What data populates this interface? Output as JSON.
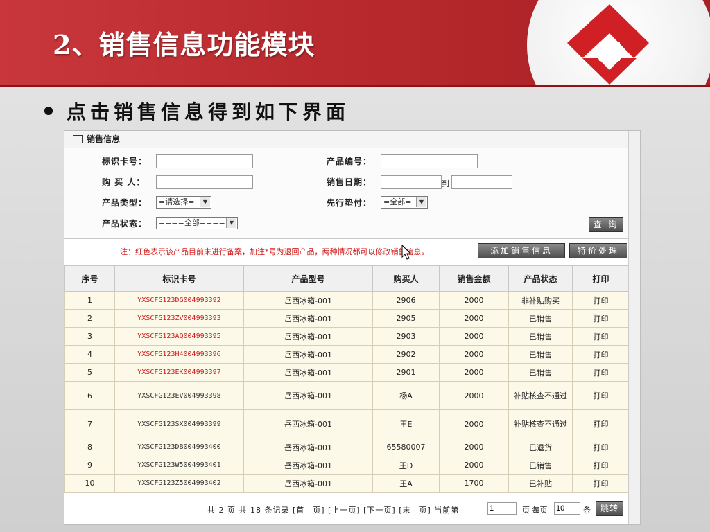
{
  "slide": {
    "title": "2、销售信息功能模块",
    "bullet": "点击销售信息得到如下界面"
  },
  "panel": {
    "title": "销售信息"
  },
  "form": {
    "card_label": "标识卡号：",
    "buyer_label": "购 买 人：",
    "type_label": "产品类型：",
    "state_label": "产品状态：",
    "product_no_label": "产品编号：",
    "date_label": "销售日期：",
    "date_to": "到",
    "advance_label": "先行垫付：",
    "type_value": "=请选择=",
    "advance_value": "=全部=",
    "state_value": "====全部=====",
    "query_button": "查 询"
  },
  "notice": "注：红色表示该产品目前未进行备案，加注*号为退回产品，两种情况都可以修改销售信息。",
  "actions": {
    "add_button": "添加销售信息",
    "special_button": "特价处理"
  },
  "table": {
    "headers": [
      "序号",
      "标识卡号",
      "产品型号",
      "购买人",
      "销售金额",
      "产品状态",
      "打印"
    ],
    "rows": [
      {
        "no": "1",
        "card": "YXSCFG123DG004993392",
        "model": "岳西冰箱-001",
        "buyer": "2906",
        "amount": "2000",
        "status": "非补贴购买",
        "print": "打印",
        "red": true
      },
      {
        "no": "2",
        "card": "YXSCFG123ZV004993393",
        "model": "岳西冰箱-001",
        "buyer": "2905",
        "amount": "2000",
        "status": "已销售",
        "print": "打印",
        "red": true
      },
      {
        "no": "3",
        "card": "YXSCFG123AQ004993395",
        "model": "岳西冰箱-001",
        "buyer": "2903",
        "amount": "2000",
        "status": "已销售",
        "print": "打印",
        "red": true
      },
      {
        "no": "4",
        "card": "YXSCFG123H4004993396",
        "model": "岳西冰箱-001",
        "buyer": "2902",
        "amount": "2000",
        "status": "已销售",
        "print": "打印",
        "red": true
      },
      {
        "no": "5",
        "card": "YXSCFG123EK004993397",
        "model": "岳西冰箱-001",
        "buyer": "2901",
        "amount": "2000",
        "status": "已销售",
        "print": "打印",
        "red": true
      },
      {
        "no": "6",
        "card": "YXSCFG123EV004993398",
        "model": "岳西冰箱-001",
        "buyer": "杨A",
        "amount": "2000",
        "status": "补贴核查不通过",
        "print": "打印",
        "red": false
      },
      {
        "no": "7",
        "card": "YXSCFG123SX004993399",
        "model": "岳西冰箱-001",
        "buyer": "王E",
        "amount": "2000",
        "status": "补贴核查不通过",
        "print": "打印",
        "red": false
      },
      {
        "no": "8",
        "card": "YXSCFG123DB004993400",
        "model": "岳西冰箱-001",
        "buyer": "65580007",
        "amount": "2000",
        "status": "已退货",
        "print": "打印",
        "red": false
      },
      {
        "no": "9",
        "card": "YXSCFG123W5004993401",
        "model": "岳西冰箱-001",
        "buyer": "王D",
        "amount": "2000",
        "status": "已销售",
        "print": "打印",
        "red": false
      },
      {
        "no": "10",
        "card": "YXSCFG123Z5004993402",
        "model": "岳西冰箱-001",
        "buyer": "王A",
        "amount": "1700",
        "status": "已补贴",
        "print": "打印",
        "red": false
      }
    ]
  },
  "pager": {
    "text": "共 2 页 共 18 条记录 [首　页] [上一页] [下一页] [末　页] 当前第",
    "current_page": "1",
    "per_page_label": "页 每页",
    "per_page": "10",
    "unit": "条",
    "jump_button": "跳转"
  },
  "colors": {
    "header_red": "#b92a2e",
    "notice_red": "#d02020",
    "row_bg": "#fdf9e8"
  }
}
